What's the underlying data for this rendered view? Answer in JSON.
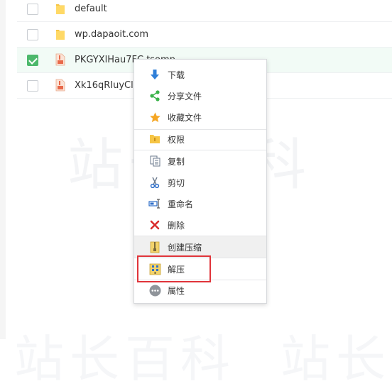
{
  "watermark": {
    "text": "站长百科"
  },
  "files": [
    {
      "name": "default",
      "type": "folder",
      "checked": false
    },
    {
      "name": "wp.dapaoit.com",
      "type": "folder",
      "checked": false
    },
    {
      "name": "PKGYXlHau7FC.tsomp",
      "type": "archive",
      "checked": true
    },
    {
      "name": "Xk16qRIuyClE.",
      "type": "archive",
      "checked": false
    }
  ],
  "context_menu": {
    "items": [
      {
        "label": "下载",
        "icon": "download-icon"
      },
      {
        "label": "分享文件",
        "icon": "share-icon"
      },
      {
        "label": "收藏文件",
        "icon": "star-icon"
      },
      {
        "label": "权限",
        "icon": "folder-permission-icon"
      },
      {
        "label": "复制",
        "icon": "copy-icon"
      },
      {
        "label": "剪切",
        "icon": "scissors-icon"
      },
      {
        "label": "重命名",
        "icon": "rename-icon"
      },
      {
        "label": "删除",
        "icon": "delete-x-icon"
      },
      {
        "label": "创建压缩",
        "icon": "zip-create-icon"
      },
      {
        "label": "解压",
        "icon": "unzip-icon"
      },
      {
        "label": "属性",
        "icon": "properties-icon"
      }
    ]
  },
  "colors": {
    "checkbox_checked": "#4cb86b",
    "highlight_border": "#e0343a",
    "menu_hover": "#f0f0f0"
  }
}
